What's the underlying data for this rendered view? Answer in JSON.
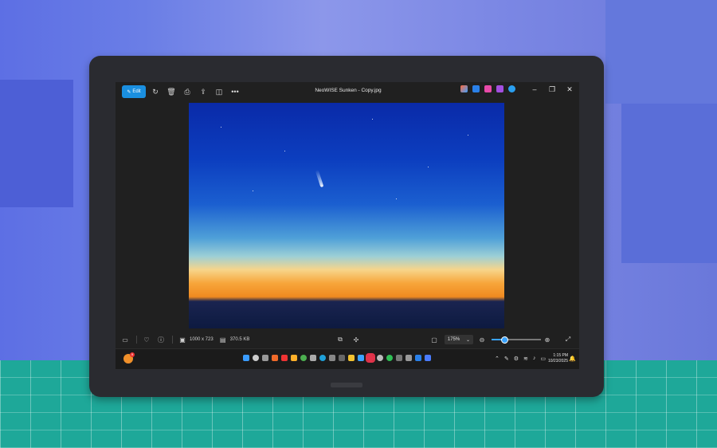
{
  "window": {
    "title": "NeoWISE Sunken - Copy.jpg",
    "edit_label": "Edit"
  },
  "toolbar": {
    "icons": [
      "edit-icon",
      "rotate-icon",
      "delete-icon",
      "print-icon",
      "share-icon",
      "screenshot-icon",
      "more-icon"
    ]
  },
  "window_controls": [
    "minimize",
    "restore",
    "close"
  ],
  "info": {
    "dimensions": "1000 x 723",
    "file_size": "370.5 KB",
    "zoom": "175%",
    "zoom_fraction": 0.25
  },
  "taskbar": {
    "badge": "9",
    "time": "1:15 PM",
    "date": "10/23/2025"
  },
  "colors": {
    "accent": "#1a8fe0",
    "sky_top": "#0a2aa8",
    "horizon": "#f08a20"
  }
}
